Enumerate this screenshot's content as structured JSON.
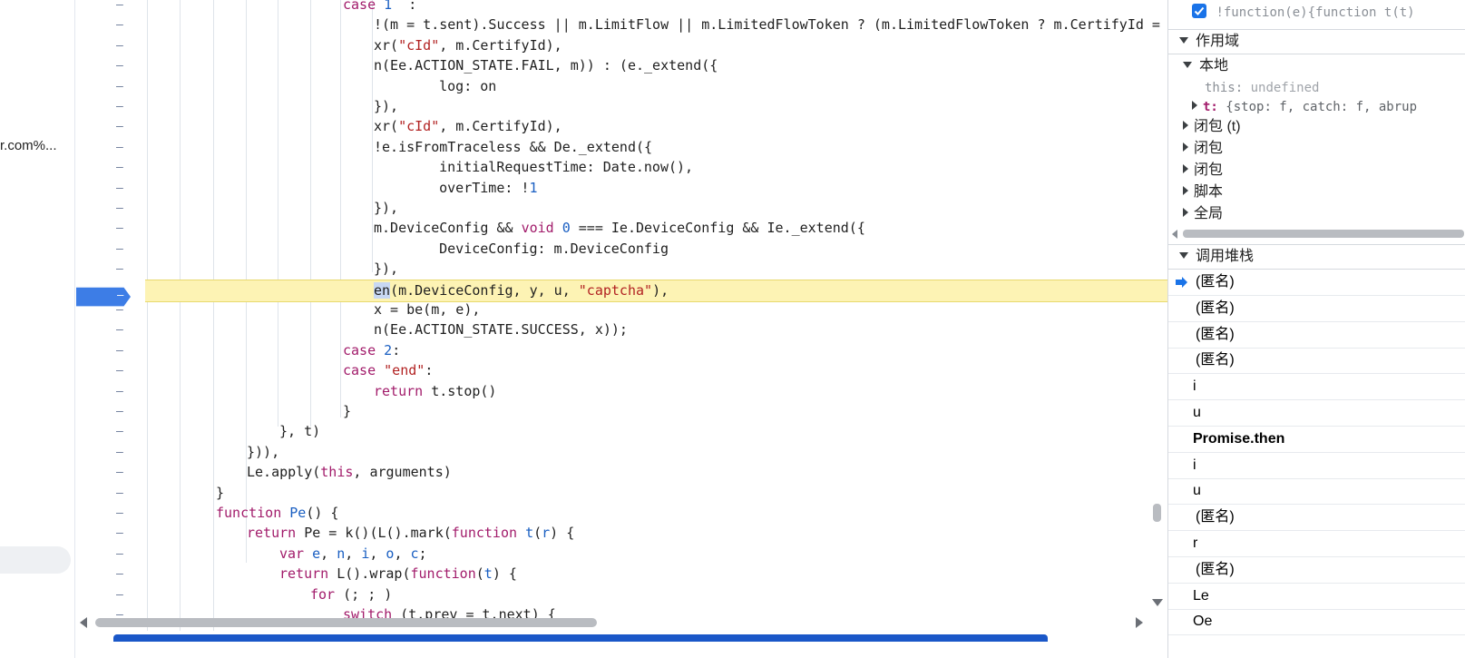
{
  "left": {
    "url_fragment": "r.com%..."
  },
  "code": {
    "lines": [
      {
        "segs": [
          [
            "kw",
            "case "
          ],
          [
            "num",
            "1"
          ],
          [
            "",
            "  :"
          ]
        ]
      },
      {
        "segs": [
          [
            "",
            "!(m = t.sent).Success || m.LimitFlow || m.LimitedFlowToken ? (m.LimitedFlowToken ? m.CertifyId = m"
          ]
        ]
      },
      {
        "segs": [
          [
            "",
            "xr("
          ],
          [
            "str",
            "\"cId\""
          ],
          [
            "",
            ", m.CertifyId),"
          ]
        ]
      },
      {
        "segs": [
          [
            "",
            "n(Ee.ACTION_STATE.FAIL, m)) : (e._extend({"
          ]
        ]
      },
      {
        "segs": [
          [
            "",
            "    log: on"
          ]
        ]
      },
      {
        "segs": [
          [
            "",
            "}),"
          ]
        ]
      },
      {
        "segs": [
          [
            "",
            "xr("
          ],
          [
            "str",
            "\"cId\""
          ],
          [
            "",
            ", m.CertifyId),"
          ]
        ]
      },
      {
        "segs": [
          [
            "",
            "!e.isFromTraceless && De._extend({"
          ]
        ]
      },
      {
        "segs": [
          [
            "",
            "    initialRequestTime: Date.now(),"
          ]
        ]
      },
      {
        "segs": [
          [
            "",
            "    overTime: !"
          ],
          [
            "num",
            "1"
          ]
        ]
      },
      {
        "segs": [
          [
            "",
            "}),"
          ]
        ]
      },
      {
        "segs": [
          [
            "",
            "m.DeviceConfig && "
          ],
          [
            "kw",
            "void"
          ],
          [
            "",
            " "
          ],
          [
            "num",
            "0"
          ],
          [
            "",
            " === Ie.DeviceConfig && Ie._extend({"
          ]
        ]
      },
      {
        "segs": [
          [
            "",
            "    DeviceConfig: m.DeviceConfig"
          ]
        ]
      },
      {
        "segs": [
          [
            "",
            "}),"
          ]
        ]
      },
      {
        "segs": [
          [
            "sel",
            "en"
          ],
          [
            "",
            "(m.DeviceConfig, y, u, "
          ],
          [
            "str",
            "\"captcha\""
          ],
          [
            "",
            "),"
          ]
        ]
      },
      {
        "segs": [
          [
            "",
            "x = be(m, e),"
          ]
        ]
      },
      {
        "segs": [
          [
            "",
            "n(Ee.ACTION_STATE.SUCCESS, x));"
          ]
        ]
      },
      {
        "segs": [
          [
            "kw",
            "case "
          ],
          [
            "num",
            "2"
          ],
          [
            "",
            ":"
          ]
        ]
      },
      {
        "segs": [
          [
            "kw",
            "case "
          ],
          [
            "str",
            "\"end\""
          ],
          [
            "",
            ":"
          ]
        ]
      },
      {
        "segs": [
          [
            "kw",
            "return"
          ],
          [
            "",
            " t.stop()"
          ]
        ]
      },
      {
        "segs": [
          [
            "",
            "}"
          ]
        ]
      },
      {
        "segs": [
          [
            "",
            "}, t)"
          ]
        ]
      },
      {
        "segs": [
          [
            "",
            "})),"
          ]
        ]
      },
      {
        "segs": [
          [
            "",
            "Le.apply("
          ],
          [
            "kw",
            "this"
          ],
          [
            "",
            ", arguments)"
          ]
        ]
      },
      {
        "segs": [
          [
            "",
            "}"
          ]
        ]
      },
      {
        "segs": [
          [
            "kw",
            "function"
          ],
          [
            "",
            " "
          ],
          [
            "num",
            "Pe"
          ],
          [
            "",
            "() {"
          ]
        ]
      },
      {
        "segs": [
          [
            "kw",
            "return"
          ],
          [
            "",
            " Pe = k()(L().mark("
          ],
          [
            "kw",
            "function"
          ],
          [
            "",
            " "
          ],
          [
            "num",
            "t"
          ],
          [
            "",
            "("
          ],
          [
            "num",
            "r"
          ],
          [
            "",
            ") {"
          ]
        ]
      },
      {
        "segs": [
          [
            "kw",
            "var"
          ],
          [
            "",
            " "
          ],
          [
            "num",
            "e"
          ],
          [
            "",
            ", "
          ],
          [
            "num",
            "n"
          ],
          [
            "",
            ", "
          ],
          [
            "num",
            "i"
          ],
          [
            "",
            ", "
          ],
          [
            "num",
            "o"
          ],
          [
            "",
            ", "
          ],
          [
            "num",
            "c"
          ],
          [
            "",
            ";"
          ]
        ]
      },
      {
        "segs": [
          [
            "kw",
            "return"
          ],
          [
            "",
            " L().wrap("
          ],
          [
            "kw",
            "function"
          ],
          [
            "",
            "("
          ],
          [
            "num",
            "t"
          ],
          [
            "",
            ") {"
          ]
        ]
      },
      {
        "segs": [
          [
            "kw",
            "for"
          ],
          [
            "",
            " (; ; )"
          ]
        ]
      },
      {
        "segs": [
          [
            "kw",
            "switch"
          ],
          [
            "",
            " (t.prev = t.next) {"
          ]
        ]
      }
    ]
  },
  "panel": {
    "watch_expr": "!function(e){function t(t)",
    "scope_title": "作用域",
    "local_label": "本地",
    "this_label": "this:",
    "this_value": "undefined",
    "t_label": "t:",
    "t_value": "{stop: f, catch: f, abrup",
    "closure_t": "闭包 (t)",
    "closure1": "闭包",
    "closure2": "闭包",
    "script": "脚本",
    "global": "全局",
    "callstack_title": "调用堆栈",
    "frames": [
      "(匿名)",
      "(匿名)",
      "(匿名)",
      "(匿名)",
      "i",
      "u",
      "Promise.then",
      "i",
      "u",
      "(匿名)",
      "r",
      "(匿名)",
      "Le",
      "Oe"
    ]
  }
}
